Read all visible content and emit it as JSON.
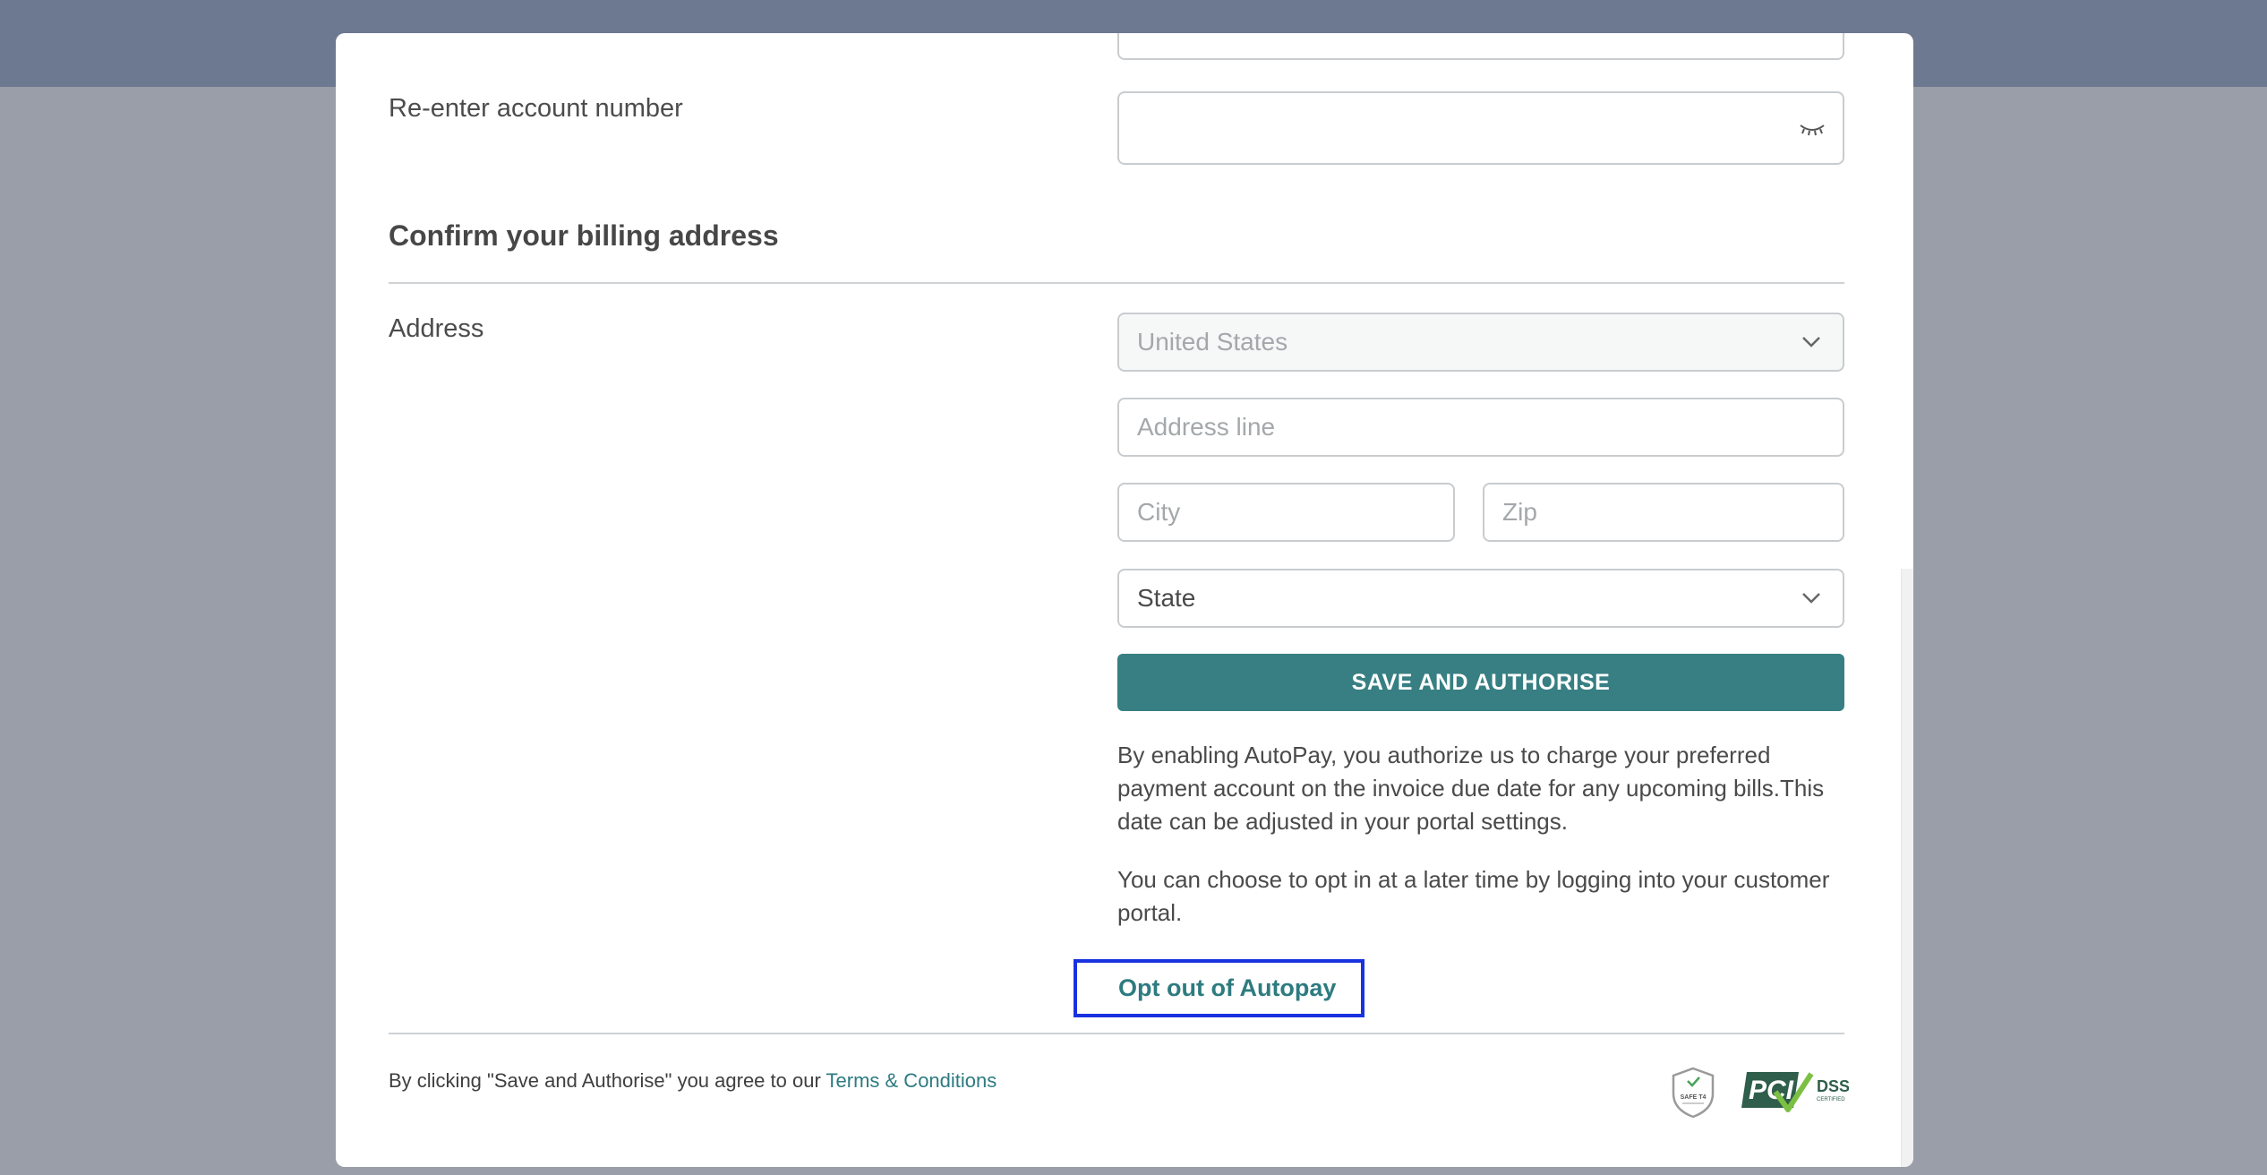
{
  "form": {
    "reenter_label": "Re-enter account number",
    "reenter_value": "",
    "section_title": "Confirm your billing address",
    "address_label": "Address",
    "country_value": "United States",
    "address_placeholder": "Address line",
    "city_placeholder": "City",
    "zip_placeholder": "Zip",
    "state_value": "State"
  },
  "actions": {
    "save_label": "SAVE AND AUTHORISE",
    "optout_label": "Opt out of Autopay"
  },
  "text": {
    "autopay_notice": "By enabling AutoPay, you authorize us to charge your preferred payment account on the invoice due date for any upcoming bills.This date can be adjusted in your portal settings.",
    "optin_notice": "You can choose to opt in at a later time by logging into your customer portal."
  },
  "footer": {
    "agree_text": "By clicking \"Save and Authorise\" you agree to our ",
    "terms_link": "Terms & Conditions",
    "badge_safe_text": "SAFE T4",
    "badge_pci_text": "PCI",
    "badge_dss_text": "DSS",
    "badge_certified_text": "CERTIFIED"
  },
  "colors": {
    "accent": "#377f83",
    "link": "#2e7b80",
    "focus_outline": "#1932e0",
    "backdrop": "#9a9ea8",
    "topbar": "#6d7891"
  }
}
